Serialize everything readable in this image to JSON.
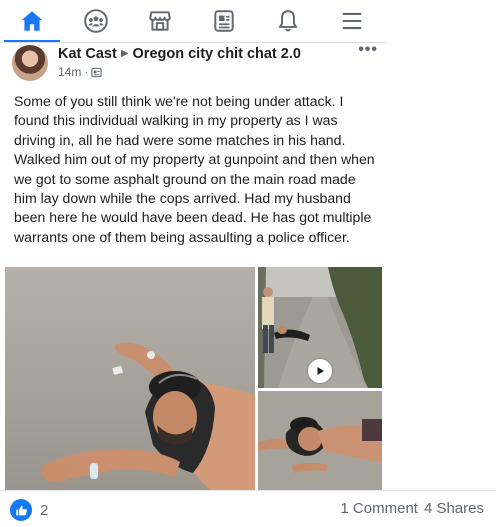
{
  "nav": {
    "tabs": [
      {
        "icon": "home-icon",
        "active": true
      },
      {
        "icon": "groups-icon",
        "active": false
      },
      {
        "icon": "marketplace-icon",
        "active": false
      },
      {
        "icon": "news-icon",
        "active": false
      },
      {
        "icon": "notifications-icon",
        "active": false
      },
      {
        "icon": "menu-icon",
        "active": false
      }
    ],
    "accent_color": "#1877f2"
  },
  "post": {
    "author": "Kat Cast",
    "group": "Oregon city chit chat 2.0",
    "time": "14m",
    "more_label": "•••",
    "text": "Some of you still think we're not being under attack. I found this individual walking in my property as I was driving in, all he had were some matches in his hand. Walked him out of my property at gunpoint and then when we got to some asphalt ground on the main road made him lay down while the cops arrived. Had my husband been here he would have been dead. He has got multiple warrants one of them being assaulting a police officer."
  },
  "footer": {
    "reaction_count": "2",
    "comments": "1 Comment",
    "shares": "4 Shares"
  }
}
